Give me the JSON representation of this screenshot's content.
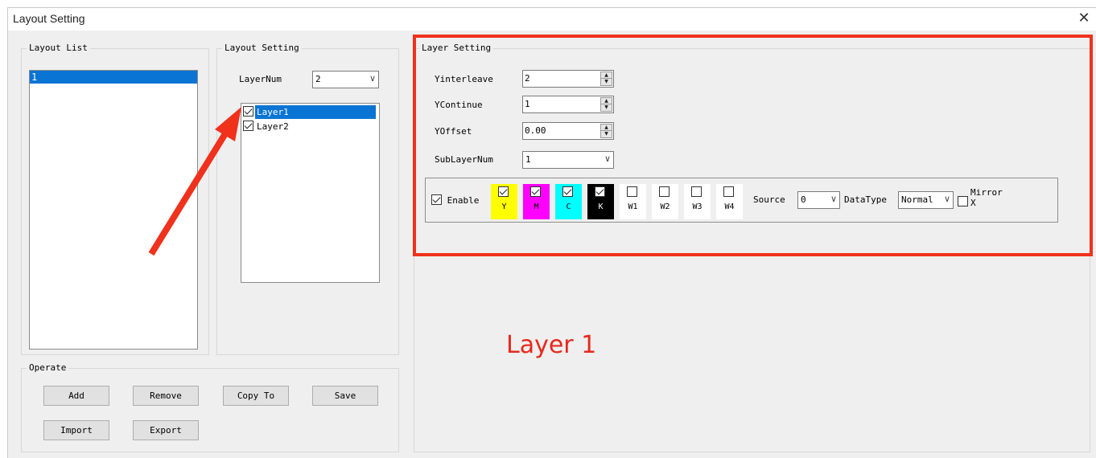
{
  "window": {
    "title": "Layout Setting",
    "close_glyph": "✕"
  },
  "layout_list": {
    "legend": "Layout List",
    "items": [
      "1"
    ],
    "selected": "1"
  },
  "layout_setting": {
    "legend": "Layout Setting",
    "layer_num_label": "LayerNum",
    "layer_num_value": "2",
    "layers": [
      {
        "label": "Layer1",
        "checked": true,
        "selected": true
      },
      {
        "label": "Layer2",
        "checked": true,
        "selected": false
      }
    ]
  },
  "operate": {
    "legend": "Operate",
    "buttons": {
      "add": "Add",
      "remove": "Remove",
      "copy_to": "Copy To",
      "save": "Save",
      "import": "Import",
      "export": "Export"
    }
  },
  "layer_setting": {
    "legend": "Layer Setting",
    "yinterleave_label": "Yinterleave",
    "yinterleave_value": "2",
    "ycontinue_label": "YContinue",
    "ycontinue_value": "1",
    "yoffset_label": "YOffset",
    "yoffset_value": "0.00",
    "sublayernum_label": "SubLayerNum",
    "sublayernum_value": "1",
    "enable_label": "Enable",
    "enable_checked": true,
    "channels": [
      {
        "name": "Y",
        "checked": true,
        "color": "#ffff00",
        "text_color": "#000000"
      },
      {
        "name": "M",
        "checked": true,
        "color": "#ff00ff",
        "text_color": "#000000"
      },
      {
        "name": "C",
        "checked": true,
        "color": "#00ffff",
        "text_color": "#000000"
      },
      {
        "name": "K",
        "checked": true,
        "color": "#000000",
        "text_color": "#ffffff"
      },
      {
        "name": "W1",
        "checked": false,
        "color": "#ffffff",
        "text_color": "#000000"
      },
      {
        "name": "W2",
        "checked": false,
        "color": "#ffffff",
        "text_color": "#000000"
      },
      {
        "name": "W3",
        "checked": false,
        "color": "#ffffff",
        "text_color": "#000000"
      },
      {
        "name": "W4",
        "checked": false,
        "color": "#ffffff",
        "text_color": "#000000"
      }
    ],
    "source_label": "Source",
    "source_value": "0",
    "datatype_label": "DataType",
    "datatype_value": "Normal",
    "mirror_label_line1": "Mirror",
    "mirror_label_line2": "X",
    "mirror_checked": false
  },
  "annotation": {
    "text": "Layer 1",
    "color": "#e8281d",
    "highlight_color": "#f0311c",
    "arrow_color": "#f0311c"
  },
  "colors": {
    "selection": "#0a74d4",
    "window_bg": "#efefef"
  }
}
